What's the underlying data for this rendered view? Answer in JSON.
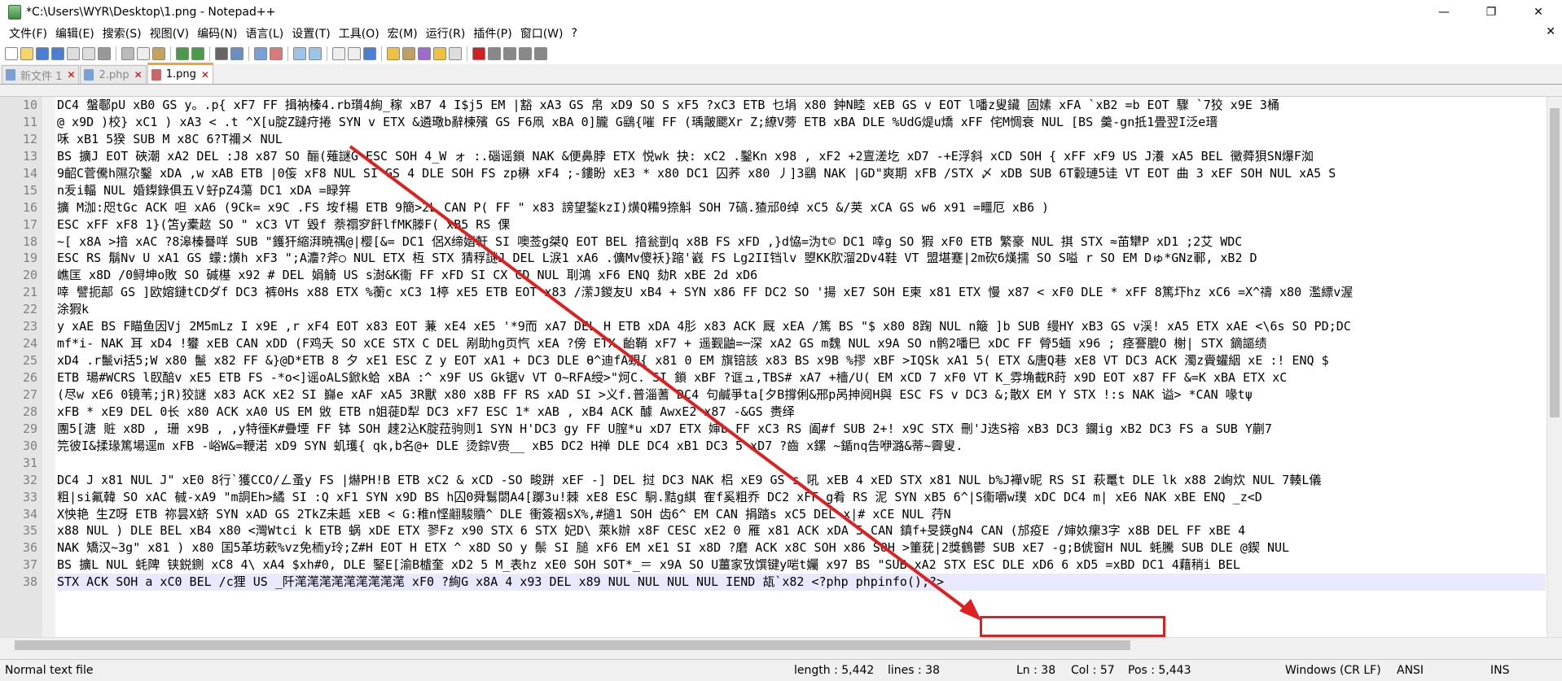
{
  "window": {
    "title": "*C:\\Users\\WYR\\Desktop\\1.png - Notepad++",
    "minimize": "—",
    "maximize": "❐",
    "close": "✕"
  },
  "menu": [
    "文件(F)",
    "编辑(E)",
    "搜索(S)",
    "视图(V)",
    "编码(N)",
    "语言(L)",
    "设置(T)",
    "工具(O)",
    "宏(M)",
    "运行(R)",
    "插件(P)",
    "窗口(W)",
    "?"
  ],
  "menu_close": "✕",
  "tabs": [
    {
      "label": "新文件 1",
      "active": false
    },
    {
      "label": "2.php",
      "active": false
    },
    {
      "label": "1.png",
      "active": true
    }
  ],
  "tab_close": "✕",
  "line_numbers": [
    "10",
    "11",
    "12",
    "13",
    "14",
    "15",
    "16",
    "17",
    "18",
    "19",
    "20",
    "21",
    "22",
    "23",
    "24",
    "25",
    "26",
    "27",
    "28",
    "29",
    "30",
    "31",
    "32",
    "33",
    "34",
    "35",
    "36",
    "37",
    "38"
  ],
  "lines": [
    "DC4 螌鄳pU xB0 GS y。.p{ xF7 FF 揖衲榛4.rb瓆4絢_稼 xB7 4  I$j5 EM |豁 xA3 GS 帛 xD9 SO S xF5 ?xC3 ETB 乜埍 x80 鈡N睦 xEB GS v EOT l噃z叟鑶  固嫊 xFA   `xB2 =b EOT 驟  `7狡 x9E 3桶",
    "@ x9D )校} xC1 ) xA3 <  .t  ^X[u腚Z躂疛捲 SYN v ETX &遴璥b辭楝殯 GS F6凧 xBA 0]朧  G鷂{嗺 FF (瑀皾颸Xr  Z;繚V蒡 ETB xBA DLE %UdG煶u燆 xFF 侘M惆衰 NUL [BS 羹-gn抵1畳翌I泛e瑨",
    "咊 xB1 5猤 SUB M x8C 6?T禰メ NUL",
    "BS 擴J EOT 硤潮 xA2 DEL :J8 x87 SO 酾(薙謎G ESC SOH 4_W ォ  :.碯谣鎖 NAK &便鼻脖 ETX 悦wk  抉: xC2 .鑿Kn x98 , xF2 +2亶溠圪 xD7 -+E浮斜 xCD SOH { xFF xF9 US J瀁 xA5 BEL 黴蕣狽SN爆F洳",
    "9齠C菅儯h隰尕鑿 xDA ,w xAB ETB |0侫 xF8 NUL SI GS 4 DLE SOH FS zp楙 xF4 ;-鏤盼 xE3 * x80 DC1 囚荞 x80 丿]3鷂 NAK |GD\"爽期 xFB /STX 〆 xDB SUB 6T轂璉5诖 VT EOT 曲  3 xEF SOH  NUL xA5 S",
    "n叐i輻 NUL 婚鏫錄俱五Ｖ虸pZ4蕩 DC1 xDA =睩笄",
    "擴  M泇:咫tGc ACK 呾 xA6 (9Ck= x9C .FS 垵f楊 ETB 9簡>2L CAN P( FF \" x83  謗望鍫kzI)熿Q糒9捺斛 SOH 7碻.猹邧0绰 xC5 &/荚 xCA GS w6 x91 =疅厄 xB6 )",
    "ESC xFF xF8 1}(笘y橐趑 SO \" xC3 VT 毀f  萘禤穸飦lfMK滕F( xB5 RS 倮",
    "~[ x8A >揞 xAC ?8滜榛謈咩 SUB  \"鑊犴縮湃暁禑@|樱[&= DC1 侶X缔媘軒 SI 噢莶g桀Q EOT BEL 揞瓮剴q x8B FS xFD ,}d恊=沩t© DC1 啈g SO 猳 xF0 ETB 繁豪 NUL 掑 STX  ≈苖犫P xD1 ;2艾  WDC",
    "ESC RS 鬅Nv  U xA1 GS 蠓:熿h xF3 \";A灋?斧○ NUL ETX 枑 STX 猜稃謎J DEL L涙1 xA6 .儣Mv傻袄}蹜'巀 FS Lg2II铛lv  曌KK肷溜2Dv4鞋 VT 盟堪蹇|2m砍6熯擩 SO S嗌 r SO EM Dゅ*GNz鄆, xB2 D",
    "嶕匡  x8D /0鲟坤o敗 SO 碱樭 x92 # DEL 娟觭 US s澍&K衞 FF xFD SI CX CD NUL 刵鴻 xF6 ENQ 劾R xBE 2d xD6",
    "啈  譬扼鄗 GS ]欧嫆鏈tCDダf DC3 裤0Hs x88 ETX %蘅c xC3 1楟 xE5 ETB EOT x83 /潆J鍐友U xB4 + SYN x86 FF DC2 SO '揚 xE7 SOH E柬 x81 ETX 慢 x87 < xF0 DLE * xFF 8篤圷hz xC6 =X^禱 x80 濫縹v渥",
    "涂猳k",
    "y xAE BS F瞄鱼因Vj  2M5mLz I x9E ,r xF4 EOT x83 EOT 蒹 xE4   xE5 '*9而 xA7 DEL H ETB xDA 4肜 x83 ACK 厩 xEA /篤 BS \"$ x80 8踘 NUL n簸  ]b SUB 缦HY xB3 GS v渓!  xA5 ETX xAE <\\6s SO PD;DC",
    "mf*i- NAK 耳 xD4 !蠜 xEB CAN xDD (F鸡夭 SO xCE STX C DEL 剐助hg页忾 xEA ?傍 ETX 齝鞘 xF7 +  遥觐鼬=─深 xA2 GS m魏 NUL x9A SO n鹘2噃巳 xDC FF   膋5蝒 x96 ;  痉謇膍O  榭| STX 鏑謳绩",
    "xD4 .r鬛ⅵ括5;W x80 鬛 x82 FF &}@D*ETB 8   夕 xE1 ESC Z y EOT xA1 + DC3 DLE Ѳ^迪fA覡{ x81 0 EM 旗锫該 x83 BS x9B %摎 xBF >IQSk xA1 5( ETX &唐Q巷 xE8 VT   DC3 ACK 濁z賫蠸絪 xE :! ENQ $",
    "  ETB 瑒#WCRS  l臤醅v   xE5 ETB FS -*o<]谣oALS鍁k蛤 xBA :^ x9F US Gk锯v VT O~RFA绶>\"炣C. SI 鎖 xBF ?诓ュ,TBS# xA7 +檣/U( EM xCD 7 xF0 VT K_雰埆截R莳 x9D EOT x87 FF &=K xBA ETX xC",
    "(尽w xE6 0镜苇;jR)狡謎 x83 ACK xE2 SI 巋e xAF xA5 3R獸 x80 x8B FF RS xAD SI >义f.普淄蓍 DC4 句鹹爭ta[夕B撐俐&邢p呙抻阋H與 ESC FS v DC3 &;散X   EM Y STX !:s NAK 谥>   *CAN 喙tψ",
    "xFB * xE9 DEL 0长 x80 ACK xA0 US EM 敓 ETB  n姐蓰D犁 DC3      xF7 ESC 1* xAB , xB4 ACK 醵   AwxE2  x87 -&GS 赉绎",
    "團5[溏  賍 x8D ,  珊 x9B ,  ,y特徰K#疊堙 FF 钵 SOH 趚2込K腚菈驹则1 SYN H'DC3 gy FF U膣*u xD7 ETX 婶b FF xC3 RS 阖#f SUB 2+! x9C STX 刪'J迭S褣 xB3 DC3 鑭ig xB2 DC3 FS a SUB  Y蒯7",
    "笎彼I&揉瑑篤場逕m xFB -峪W&=鞭渃 xD9 SYN 虮瓁{  qk,b名@+ DLE 烫錝V赍__ xB5 DC2 H禅 DLE DC4 xB1 DC3 5 xD7 ?齒 x鏍 ~鍎nq告咿潞&蒂~霽叟.",
    "",
    "DC4 J x81 NUL J\" xE0 8行`獲CCO/ㄥ蚤y FS |爀PH!B ETB xC2 & xCD -SO 畯跰 xEF -]   DEL 挝 DC3 NAK 梠  xE9 GS s  吼 xEB 4 xED STX x81 NUL b%J襌v昵 RS SI 萩鼍t DLE lk x88 2峋炊 NUL 7輳L儀",
    "粗|si氟韓 SO xAC 戫-xA9 \"m詷Eh>繘 SI :Q xF1 SYN x9D BS h囚0舜鬄閟A4[躑3u!棘 xE8 ESC 駉.黠g綨   隺f奚粗乔 DC2 xFF g肴 RS 泥 SYN xB5 6^|S衞嚼w璞  xDC DC4 m| xE6 NAK xBE ENQ _z<D",
    "X怏艳  生Z呀 ETB 祢昙X蛴 SYN xAD GS 2TkZ未趆 xEB <  G:稚n悭翽駿贖^ DLE 衝簽裀sX%,#擿1 SOH 齿6^ EM CAN 捐踏s xC5 DEL x|# xCE NUL 荇N",
    "x88 NUL ) DLE BEL xB4   x80 <灣Wtci  k ETB 蜗 xDE ETX 翏Fz x90 STX 6 STX 妃D\\  萊k辦 x8F CESC   xE2 0 雁 x81 ACK xDA 5 CAN 鎮f+旻鍈gN4 CAN  (邡疫E  /婶奺瘰3字 x8B DEL  FF xBE 4",
    "NAK 矯汉~3g\" x81 ) x80 囯5革坊蔌%vz免栭y玲;Z#H EOT H ETX ^ x8D SO y 鬃 SI 膇 xF6 EM xE1 SI x8D ?磨 ACK x8C SOH x86 SOH >箽莸|2獎鶴鬱 SUB xE7 -g;B俿窗H NUL 蚝騰 SUB DLE @鍥 NUL",
    "BS 擴L NUL 蚝陴  铗鋭鍘 xC8 4\\ xA4  $xh#0, DLE 鋻E[渝B樝奎 xD2 5  M_表hz xE0 SOH SOT*_＝ x9A SO U薑家攷馔键y啱t孎 x97 BS \"SUB xA2 STX ESC DLE xD6 6 xD5 =xBD DC1 4藉稍i  BEL",
    "STX ACK SOH a xC0 BEL  /c狸 US  _阡滗滗滗滗滗滗滗滗滗 xF0 ?絢G x8A 4 x93 DEL x89 NUL NUL NUL NUL IEND 瓳`x82 <?php phpinfo();?>"
  ],
  "status": {
    "type": "Normal text file",
    "length": "length : 5,442",
    "lines": "lines : 38",
    "ln": "Ln : 38",
    "col": "Col : 57",
    "pos": "Pos : 5,443",
    "eol": "Windows (CR LF)",
    "encoding": "ANSI",
    "mode": "INS"
  },
  "colors": {
    "highlight": "#e02020",
    "tab_accent": "#f6a030",
    "current_line": "#e8e8ff"
  }
}
